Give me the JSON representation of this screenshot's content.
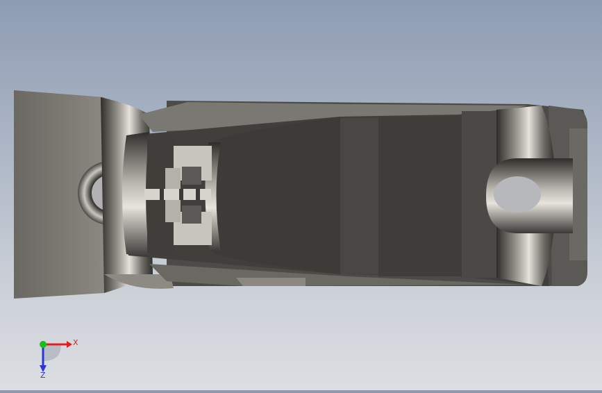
{
  "viewport": {
    "background_top": "#8e9cb2",
    "background_bottom": "#dcdee2"
  },
  "model": {
    "body_color": "#5e5c58",
    "dark_face": "#3a3936",
    "light_face": "#a9a7a0",
    "pale_face": "#c8c6bc"
  },
  "triad": {
    "x_label": "X",
    "z_label": "Z",
    "x_color": "#e02020",
    "y_color": "#19c019",
    "z_color": "#2a36d8"
  }
}
